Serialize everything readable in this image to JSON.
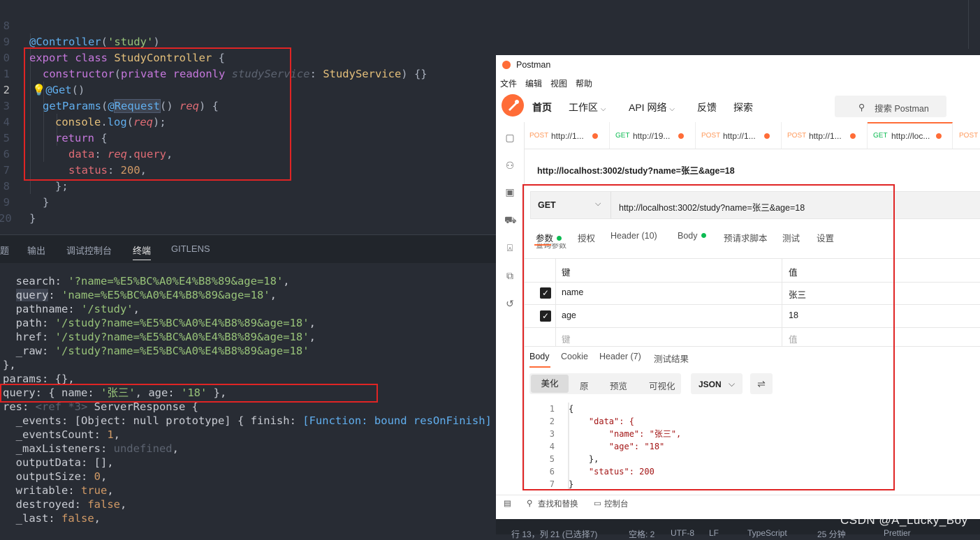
{
  "editor": {
    "lines": [
      {
        "num": "8",
        "text": "@Controller('study')"
      },
      {
        "num": "9",
        "text": "export class StudyController {"
      },
      {
        "num": "0",
        "text": "constructor(private readonly studyService: StudyService) {}"
      },
      {
        "num": "1",
        "text": "@Get()"
      },
      {
        "num": "2",
        "text": "getParams(@Request() req) {"
      },
      {
        "num": "3",
        "text": "console.log(req);"
      },
      {
        "num": "4",
        "text": "return {"
      },
      {
        "num": "5",
        "text": "data: req.query,"
      },
      {
        "num": "6",
        "text": "status: 200,"
      },
      {
        "num": "7",
        "text": "};"
      },
      {
        "num": "8",
        "text": "}"
      },
      {
        "num": "9",
        "text": "}"
      },
      {
        "num": "20",
        "text": ""
      }
    ]
  },
  "panel": {
    "tabs": [
      "题",
      "输出",
      "调试控制台",
      "终端",
      "GITLENS"
    ],
    "active_tab": "终端"
  },
  "terminal": {
    "lines": [
      "  search: '?name=%E5%BC%A0%E4%B8%89&age=18',",
      "  query: 'name=%E5%BC%A0%E4%B8%89&age=18',",
      "  pathname: '/study',",
      "  path: '/study?name=%E5%BC%A0%E4%B8%89&age=18',",
      "  href: '/study?name=%E5%BC%A0%E4%B8%89&age=18',",
      "  _raw: '/study?name=%E5%BC%A0%E4%B8%89&age=18'",
      "},",
      "params: {},",
      "query: { name: '张三', age: '18' },",
      "res: <ref *3> ServerResponse {",
      "  _events: [Object: null prototype] { finish: [Function: bound resOnFinish] },",
      "  _eventsCount: 1,",
      "  _maxListeners: undefined,",
      "  outputData: [],",
      "  outputSize: 0,",
      "  writable: true,",
      "  destroyed: false,",
      "  _last: false,"
    ]
  },
  "statusbar": {
    "position": "行 13，列 21 (已选择7)",
    "spaces": "空格: 2",
    "encoding": "UTF-8",
    "eol": "LF",
    "language": "TypeScript",
    "time": "25 分钟",
    "prettier": "Prettier"
  },
  "postman": {
    "app_title": "Postman",
    "menu": [
      "文件",
      "编辑",
      "视图",
      "帮助"
    ],
    "nav": {
      "home": "首页",
      "workspace": "工作区",
      "api_network": "API 网络",
      "feedback": "反馈",
      "explore": "探索"
    },
    "search_placeholder": "搜索 Postman",
    "tabs": [
      {
        "method": "POST",
        "url": "http://1..."
      },
      {
        "method": "GET",
        "url": "http://19..."
      },
      {
        "method": "POST",
        "url": "http://1..."
      },
      {
        "method": "POST",
        "url": "http://1..."
      },
      {
        "method": "GET",
        "url": "http://loc..."
      },
      {
        "method": "POST",
        "url": ""
      }
    ],
    "request_title": "http://localhost:3002/study?name=张三&age=18",
    "method": "GET",
    "url": "http://localhost:3002/study?name=张三&age=18",
    "request_tabs": {
      "params": "参数",
      "auth": "授权",
      "headers": "Header (10)",
      "body": "Body",
      "prerequest": "预请求脚本",
      "tests": "测试",
      "settings": "设置"
    },
    "query_params_label": "查询参数",
    "params_table": {
      "key_header": "键",
      "value_header": "值",
      "rows": [
        {
          "key": "name",
          "value": "张三"
        },
        {
          "key": "age",
          "value": "18"
        }
      ],
      "placeholder_key": "键",
      "placeholder_value": "值"
    },
    "response_tabs": {
      "body": "Body",
      "cookie": "Cookie",
      "headers": "Header (7)",
      "test_results": "测试结果"
    },
    "response_views": [
      "美化",
      "原",
      "预览",
      "可视化"
    ],
    "format": "JSON",
    "response_json_lines": [
      {
        "n": "1",
        "t": "{"
      },
      {
        "n": "2",
        "t": "    \"data\": {"
      },
      {
        "n": "3",
        "t": "        \"name\": \"张三\","
      },
      {
        "n": "4",
        "t": "        \"age\": \"18\""
      },
      {
        "n": "5",
        "t": "    },"
      },
      {
        "n": "6",
        "t": "    \"status\": 200"
      },
      {
        "n": "7",
        "t": "}"
      }
    ],
    "bottom": {
      "find_replace": "查找和替换",
      "console": "控制台"
    }
  },
  "watermark": "CSDN @A_Lucky_Boy",
  "colors": {
    "editor_bg": "#282c34",
    "annotation_red": "#e02424",
    "postman_orange": "#ff6c37",
    "get_green": "#0cbb52",
    "post_orange": "#ff9a5c"
  }
}
